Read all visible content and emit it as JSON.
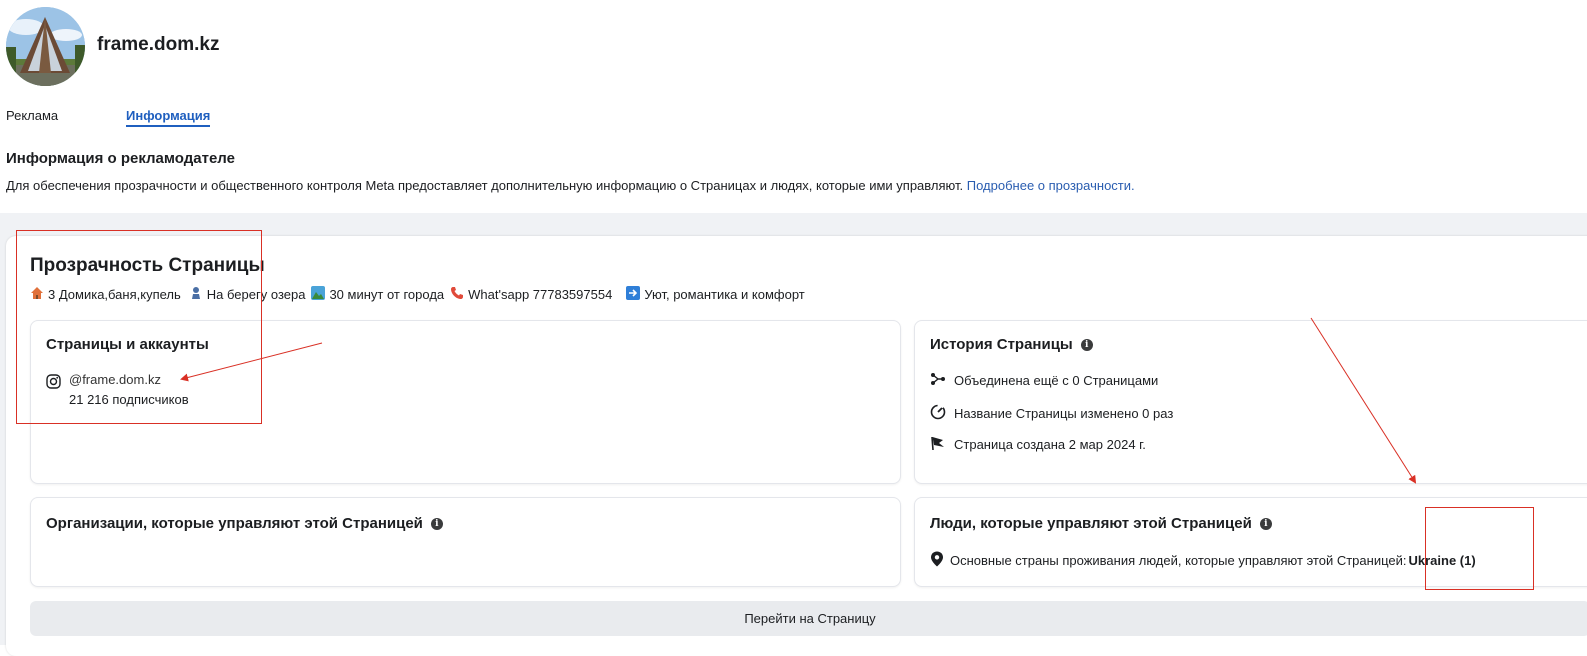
{
  "header": {
    "page_name": "frame.dom.kz",
    "avatar_icon": "page-avatar"
  },
  "tabs": [
    {
      "label": "Реклама",
      "active": false
    },
    {
      "label": "Информация",
      "active": true
    }
  ],
  "advertiser": {
    "heading": "Информация о рекламодателе",
    "text": "Для обеспечения прозрачности и общественного контроля Meta предоставляет дополнительную информацию о Страницах и людях, которые ими управляют.",
    "link": "Подробнее о прозрачности."
  },
  "transparency": {
    "title": "Прозрачность Страницы",
    "bio": [
      {
        "icon": "house-icon",
        "text": "3 Домика,баня,купель"
      },
      {
        "icon": "person-icon",
        "text": "На берегу озера"
      },
      {
        "icon": "landscape-icon",
        "text": "30 минут от города"
      },
      {
        "icon": "phone-icon",
        "text": "What'sapp 77783597554"
      },
      {
        "icon": "arrow-right-icon",
        "text": "Уют, романтика и комфорт"
      }
    ]
  },
  "accounts": {
    "title": "Страницы и аккаунты",
    "handle": "@frame.dom.kz",
    "followers": "21 216 подписчиков"
  },
  "history": {
    "title": "История Страницы",
    "items": [
      {
        "icon": "merge-icon",
        "text": "Объединена ещё с 0 Страницами"
      },
      {
        "icon": "edit-icon",
        "text": "Название Страницы изменено 0 раз"
      },
      {
        "icon": "flag-icon",
        "text": "Страница создана 2 мар 2024 г."
      }
    ]
  },
  "organizations": {
    "title": "Организации, которые управляют этой Страницей"
  },
  "people": {
    "title": "Люди, которые управляют этой Страницей",
    "countries_text": "Основные страны проживания людей, которые управляют этой Страницей:",
    "countries_value": "Ukraine (1)"
  },
  "go_button": "Перейти на Страницу",
  "annotation_color": "#d93025"
}
